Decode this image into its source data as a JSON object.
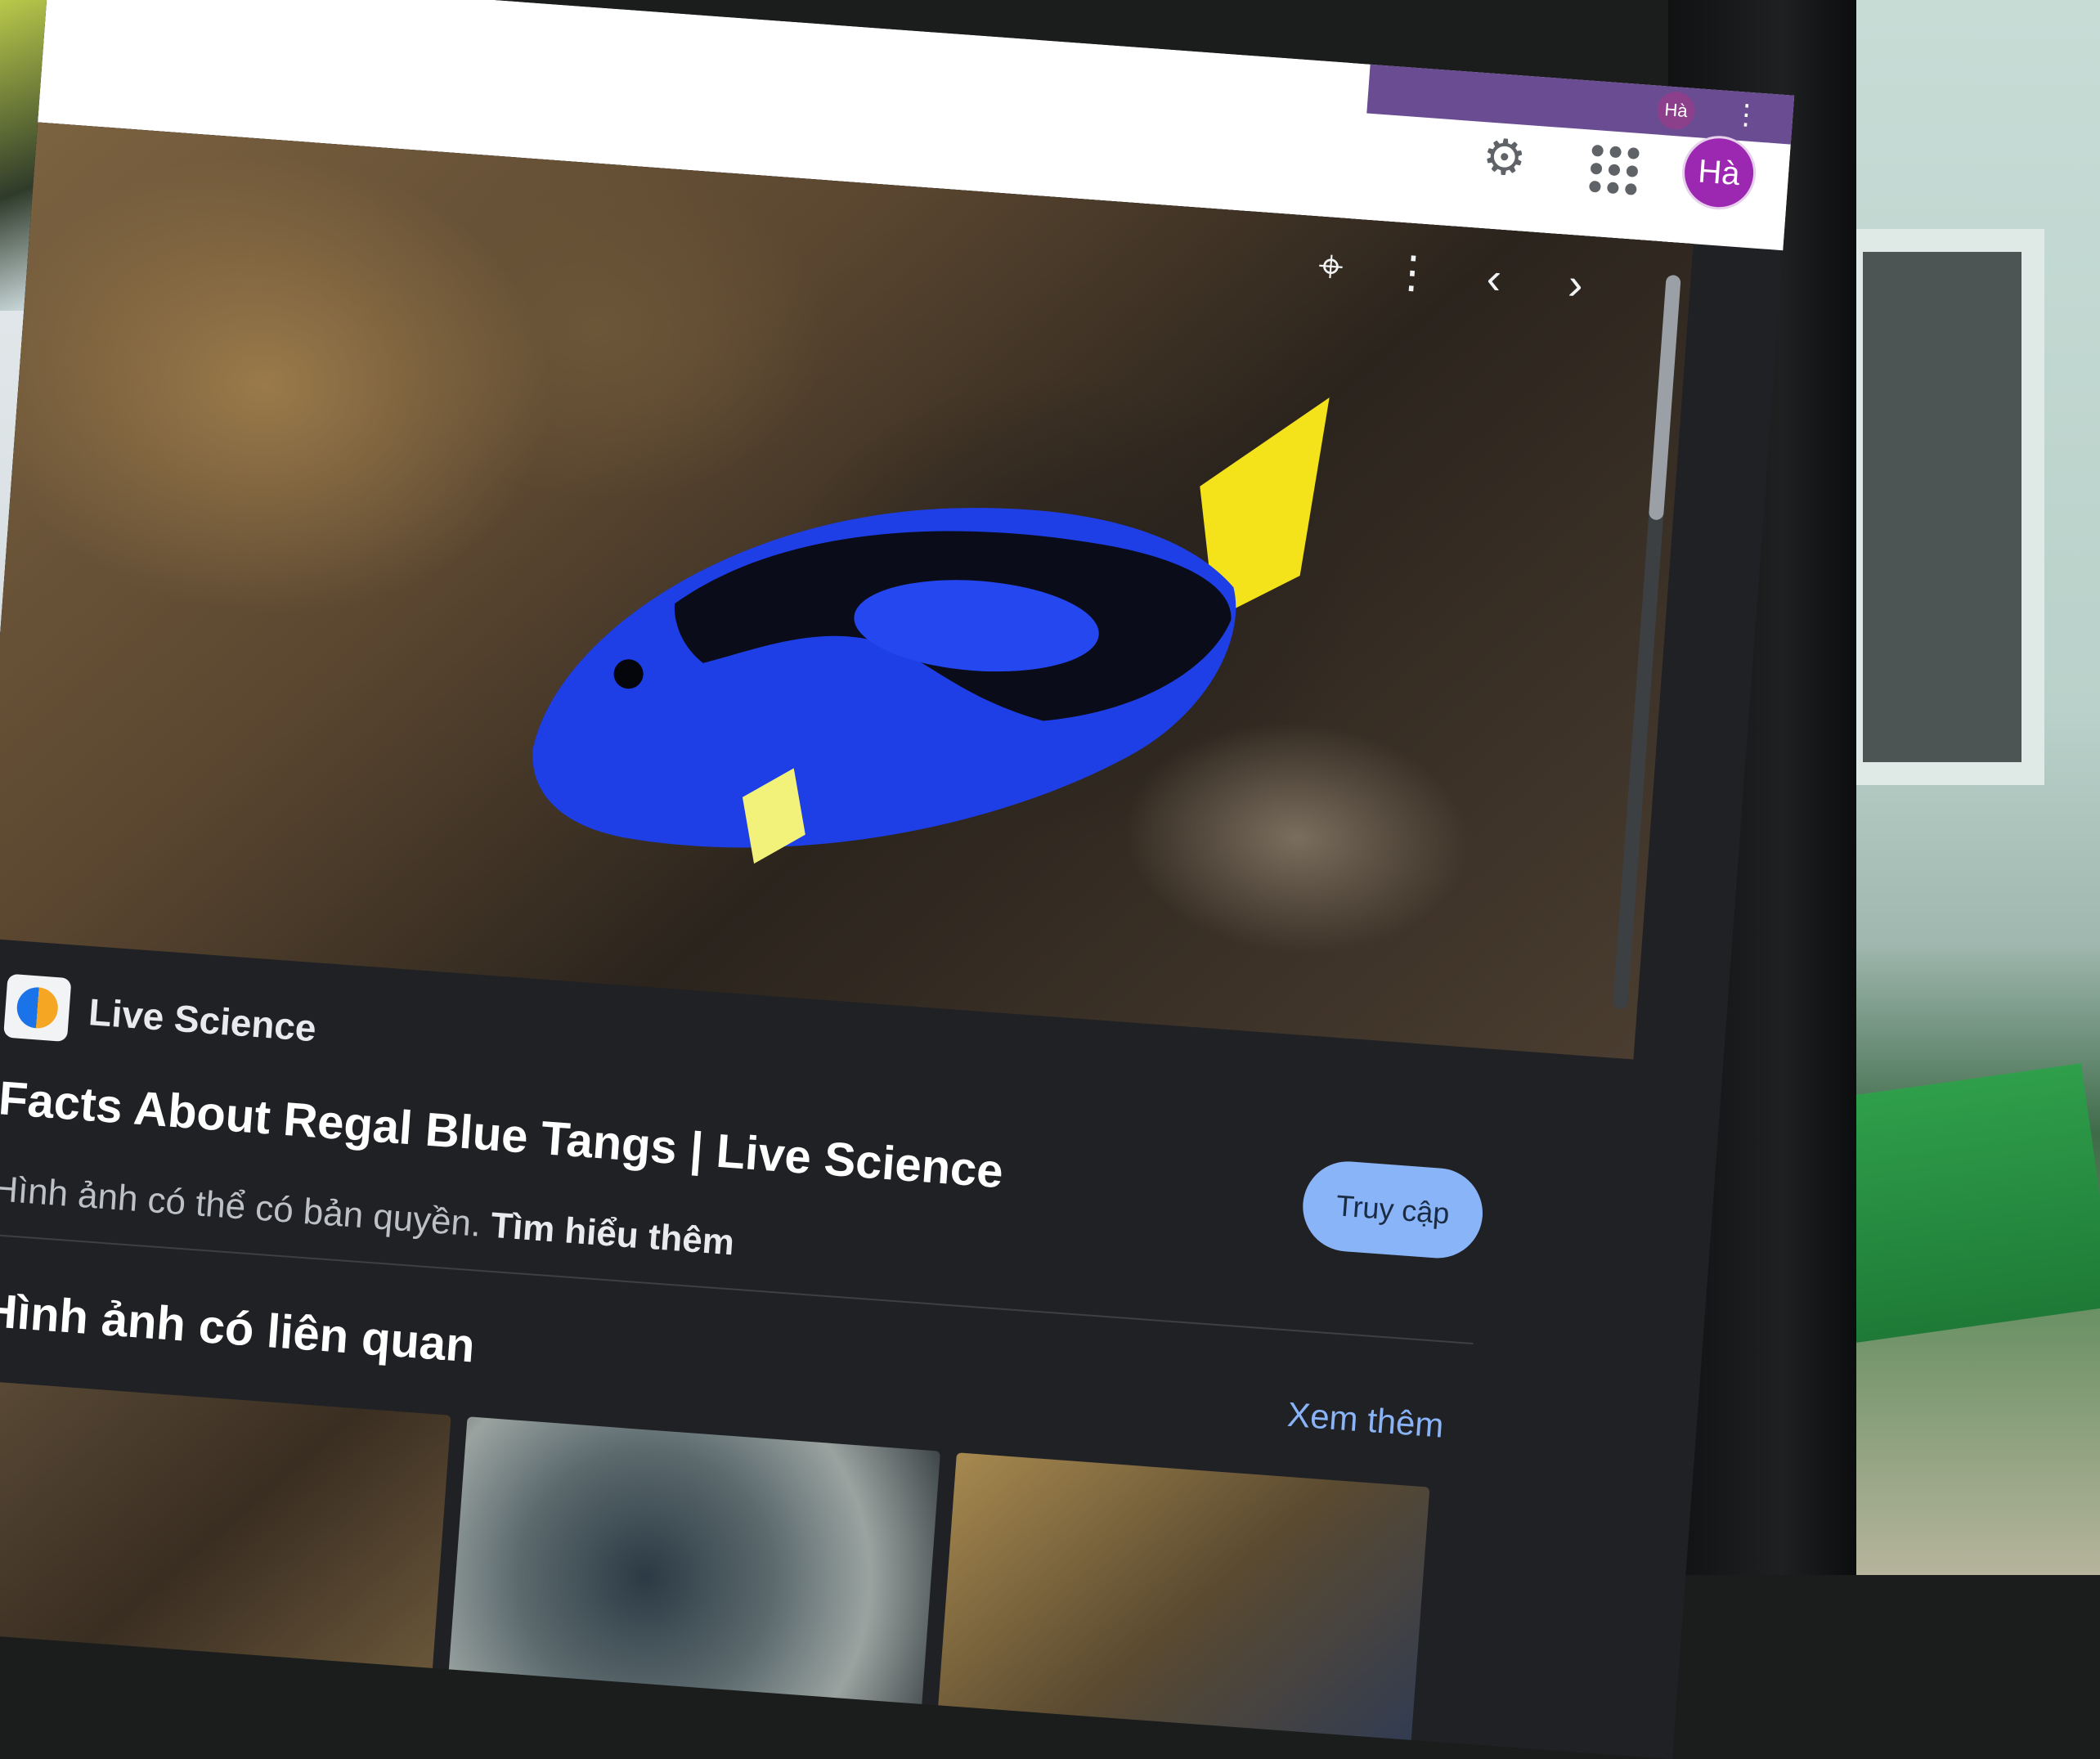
{
  "header": {
    "strip_avatar": "Hà",
    "strip_menu": "⋮",
    "settings_icon": "⚙",
    "avatar_initials": "Hà"
  },
  "viewer": {
    "lens_icon": "⌖",
    "more_icon": "⋮",
    "prev_icon": "‹",
    "next_icon": "›",
    "source_name": "Live Science",
    "title": "Facts About Regal Blue Tangs | Live Science",
    "visit_label": "Truy cập",
    "copyright_text": "Hình ảnh có thể có bản quyền.",
    "learn_more": "Tìm hiểu thêm"
  },
  "related": {
    "heading": "Hình ảnh có liên quan",
    "see_more": "Xem thêm"
  },
  "colors": {
    "accent": "#8ab4f8",
    "avatar": "#9c27b0",
    "panel_bg": "#202124"
  }
}
